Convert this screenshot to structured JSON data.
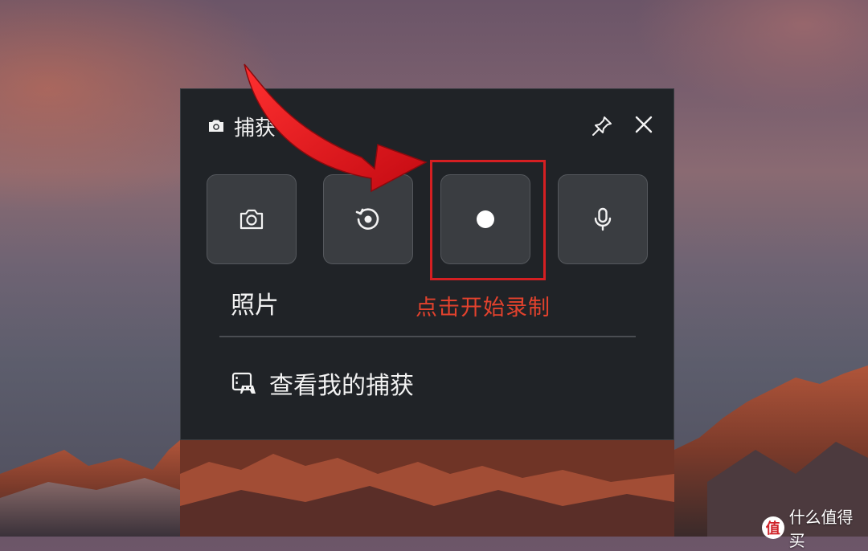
{
  "panel": {
    "title": "捕获",
    "title_icon": "camera-icon",
    "pin_icon": "pin-icon",
    "close_icon": "close-icon"
  },
  "capture_buttons": [
    {
      "icon": "camera-icon",
      "name": "photo"
    },
    {
      "icon": "replay-icon",
      "name": "record-recent"
    },
    {
      "icon": "record-dot-icon",
      "name": "start-recording"
    },
    {
      "icon": "microphone-icon",
      "name": "microphone"
    }
  ],
  "photo_label": "照片",
  "annotation": "点击开始录制",
  "gallery": {
    "icon": "gallery-icon",
    "label": "查看我的捕获"
  },
  "watermark": {
    "badge": "值",
    "text": "什么值得买"
  },
  "colors": {
    "panel_bg": "#202327",
    "tile_bg": "#3a3d41",
    "highlight": "#d51f22",
    "annotation": "#e3422d",
    "arrow": "#e0111a"
  }
}
